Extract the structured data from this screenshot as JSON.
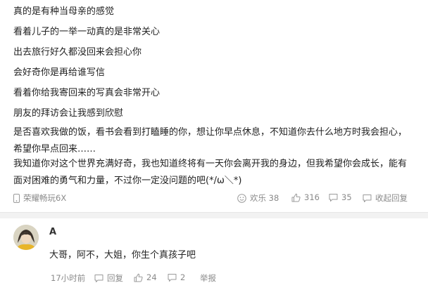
{
  "post": {
    "lines": [
      "真的是有种当母亲的感觉",
      "看着儿子的一举一动真的是非常关心",
      "出去旅行好久都没回来会担心你",
      "会好奇你是再给谁写信",
      "看着你给我寄回来的写真会非常开心",
      "朋友的拜访会让我感到欣慰"
    ],
    "paragraph_1": "是否喜欢我做的饭，看书会看到打瞌睡的你，想让你早点休息，不知道你去什么地方时我会担心，希望你早点回来……",
    "paragraph_2": "我知道你对这个世界充满好奇，我也知道终将有一天你会离开我的身边，但我希望你会成长，能有面对困难的勇气和力量，不过你一定没问题的吧(*/ω＼*)",
    "device": "荣耀畅玩6X",
    "stats": {
      "fun_label": "欢乐 38",
      "likes": "316",
      "comments": "35",
      "collapse_label": "收起回复"
    }
  },
  "reply": {
    "username": "A",
    "text": "大哥，阿不，大姐，你生个真孩子吧",
    "time": "17小时前",
    "reply_label": "回复",
    "likes": "24",
    "comments": "2",
    "report_label": "举报"
  }
}
